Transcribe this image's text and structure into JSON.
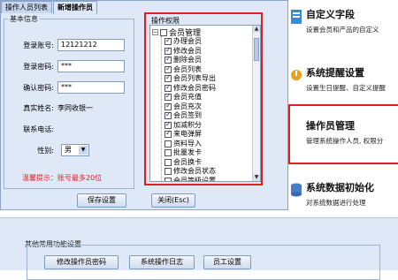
{
  "dialog": {
    "tabs": [
      {
        "label": "操作人员列表",
        "active": false
      },
      {
        "label": "新增操作员",
        "active": true
      }
    ],
    "basic_info": {
      "legend": "基本信息",
      "fields": [
        {
          "label": "登录账号:",
          "value": "12121212",
          "type": "input"
        },
        {
          "label": "登录密码:",
          "value": "***",
          "type": "input"
        },
        {
          "label": "确认密码:",
          "value": "***",
          "type": "input"
        },
        {
          "label": "真实姓名:",
          "value": "李同收银一",
          "type": "static"
        },
        {
          "label": "联系电话:",
          "value": "",
          "type": "input"
        },
        {
          "label": "性别:",
          "value": "男",
          "type": "select"
        }
      ],
      "hint": "温馨提示：账号最多20位"
    },
    "permissions": {
      "legend": "操作权限",
      "root": {
        "label": "会员管理",
        "checked": false
      },
      "items": [
        {
          "label": "办理会员",
          "checked": true
        },
        {
          "label": "修改会员",
          "checked": true
        },
        {
          "label": "删除会员",
          "checked": true
        },
        {
          "label": "会员列表",
          "checked": true
        },
        {
          "label": "会员列表导出",
          "checked": true
        },
        {
          "label": "修改会员密码",
          "checked": true
        },
        {
          "label": "会员充值",
          "checked": true
        },
        {
          "label": "会员充次",
          "checked": true
        },
        {
          "label": "会员签到",
          "checked": true
        },
        {
          "label": "加减积分",
          "checked": true
        },
        {
          "label": "来电弹屏",
          "checked": true
        },
        {
          "label": "资料导入",
          "checked": false
        },
        {
          "label": "批量发卡",
          "checked": false
        },
        {
          "label": "会员换卡",
          "checked": false
        },
        {
          "label": "修改会员状态",
          "checked": false
        },
        {
          "label": "会员等级设置",
          "checked": false
        }
      ]
    },
    "buttons": {
      "save": "保存设置",
      "close": "关闭(Esc)"
    }
  },
  "right_panel": {
    "features": [
      {
        "title": "自定义字段",
        "desc": "设置会员和产品的自定义"
      },
      {
        "title": "系统提醒设置",
        "desc": "设置生日提醒、自定义提醒"
      },
      {
        "title": "操作员管理",
        "desc": "管理系统操作人员, 权限分"
      },
      {
        "title": "系统数据初始化",
        "desc": "对系统数据进行处理"
      }
    ]
  },
  "bottom": {
    "legend": "其他常用功能设置",
    "buttons": [
      "修改操作员密码",
      "系统操作日志",
      "员工设置"
    ]
  },
  "colors": {
    "highlight_red": "#e02020",
    "panel_bg": "#dfe8f6",
    "hint_red": "#e02020"
  }
}
